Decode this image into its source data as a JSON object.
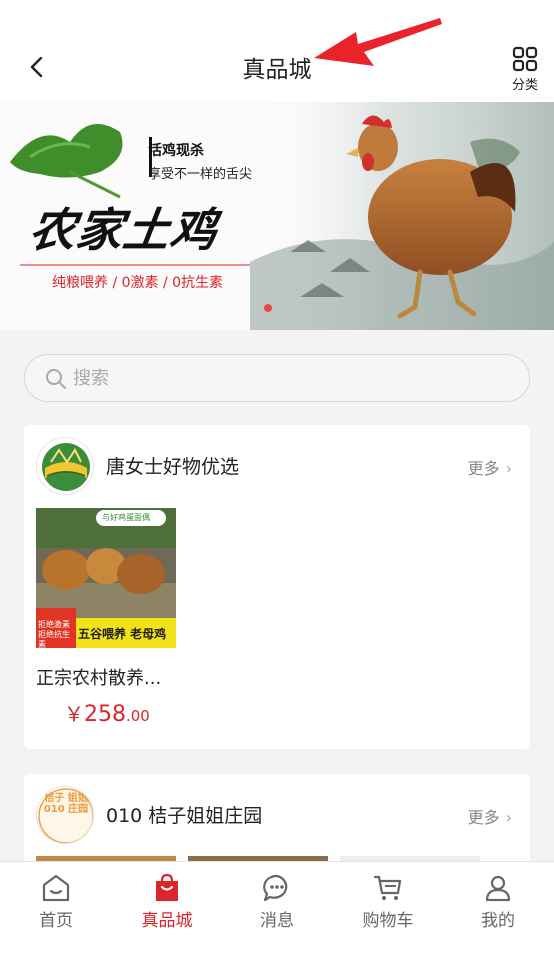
{
  "header": {
    "title": "真品城",
    "category_label": "分类"
  },
  "banner": {
    "slogan_line1": "活鸡现杀",
    "slogan_line2": "享受不一样的舌尖",
    "brand_text": "农家土鸡",
    "tagline": "纯粮喂养 / 0激素 / 0抗生素",
    "pagination": {
      "current": 1,
      "total": 1
    }
  },
  "search": {
    "placeholder": "搜索"
  },
  "stores": [
    {
      "name": "唐女士好物优选",
      "more_label": "更多",
      "product": {
        "image_tag": "与好鸡蛋面偶",
        "image_badge": "拒绝激素 拒绝抗生素",
        "image_caption": "五谷喂养 老母鸡",
        "name": "正宗农村散养...",
        "price_symbol": "￥",
        "price_int": "258",
        "price_dec": ".00"
      }
    },
    {
      "name": "010 桔子姐姐庄园",
      "more_label": "更多",
      "logo_text": "桔子 姐姐 010 庄园"
    }
  ],
  "tabbar": {
    "items": [
      {
        "label": "首页",
        "icon": "home-icon",
        "active": false
      },
      {
        "label": "真品城",
        "icon": "shopping-bag-icon",
        "active": true
      },
      {
        "label": "消息",
        "icon": "chat-icon",
        "active": false
      },
      {
        "label": "购物车",
        "icon": "cart-icon",
        "active": false
      },
      {
        "label": "我的",
        "icon": "user-icon",
        "active": false
      }
    ]
  },
  "colors": {
    "accent": "#d8262c",
    "annotation_arrow": "#e8242a"
  }
}
